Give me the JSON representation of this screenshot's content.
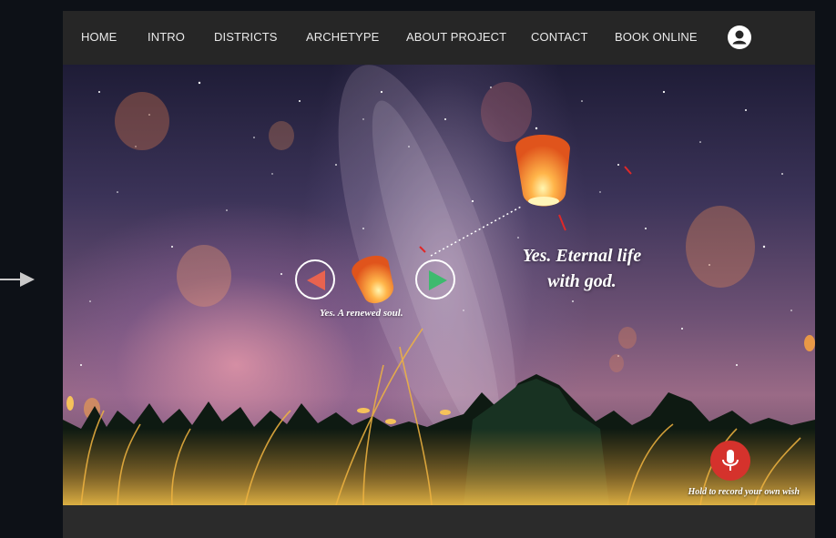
{
  "nav": {
    "items": [
      {
        "label": "HOME"
      },
      {
        "label": "INTRO"
      },
      {
        "label": "DISTRICTS"
      },
      {
        "label": "ARCHETYPE"
      },
      {
        "label": "ABOUT PROJECT"
      },
      {
        "label": "CONTACT"
      },
      {
        "label": "BOOK ONLINE"
      }
    ],
    "user_icon": "user-account-icon"
  },
  "hero": {
    "prev_icon": "triangle-left-icon",
    "next_icon": "triangle-right-icon",
    "small_caption": "Yes. A renewed soul.",
    "big_caption_line1": "Yes. Eternal life",
    "big_caption_line2": "with god.",
    "mic_icon": "microphone-icon",
    "mic_caption": "Hold to record your own wish"
  },
  "colors": {
    "nav_bg": "#262626",
    "prev_arrow": "#e8634f",
    "next_arrow": "#3dba6e",
    "mic_button": "#d5322c",
    "lantern": "#f08a2c"
  }
}
